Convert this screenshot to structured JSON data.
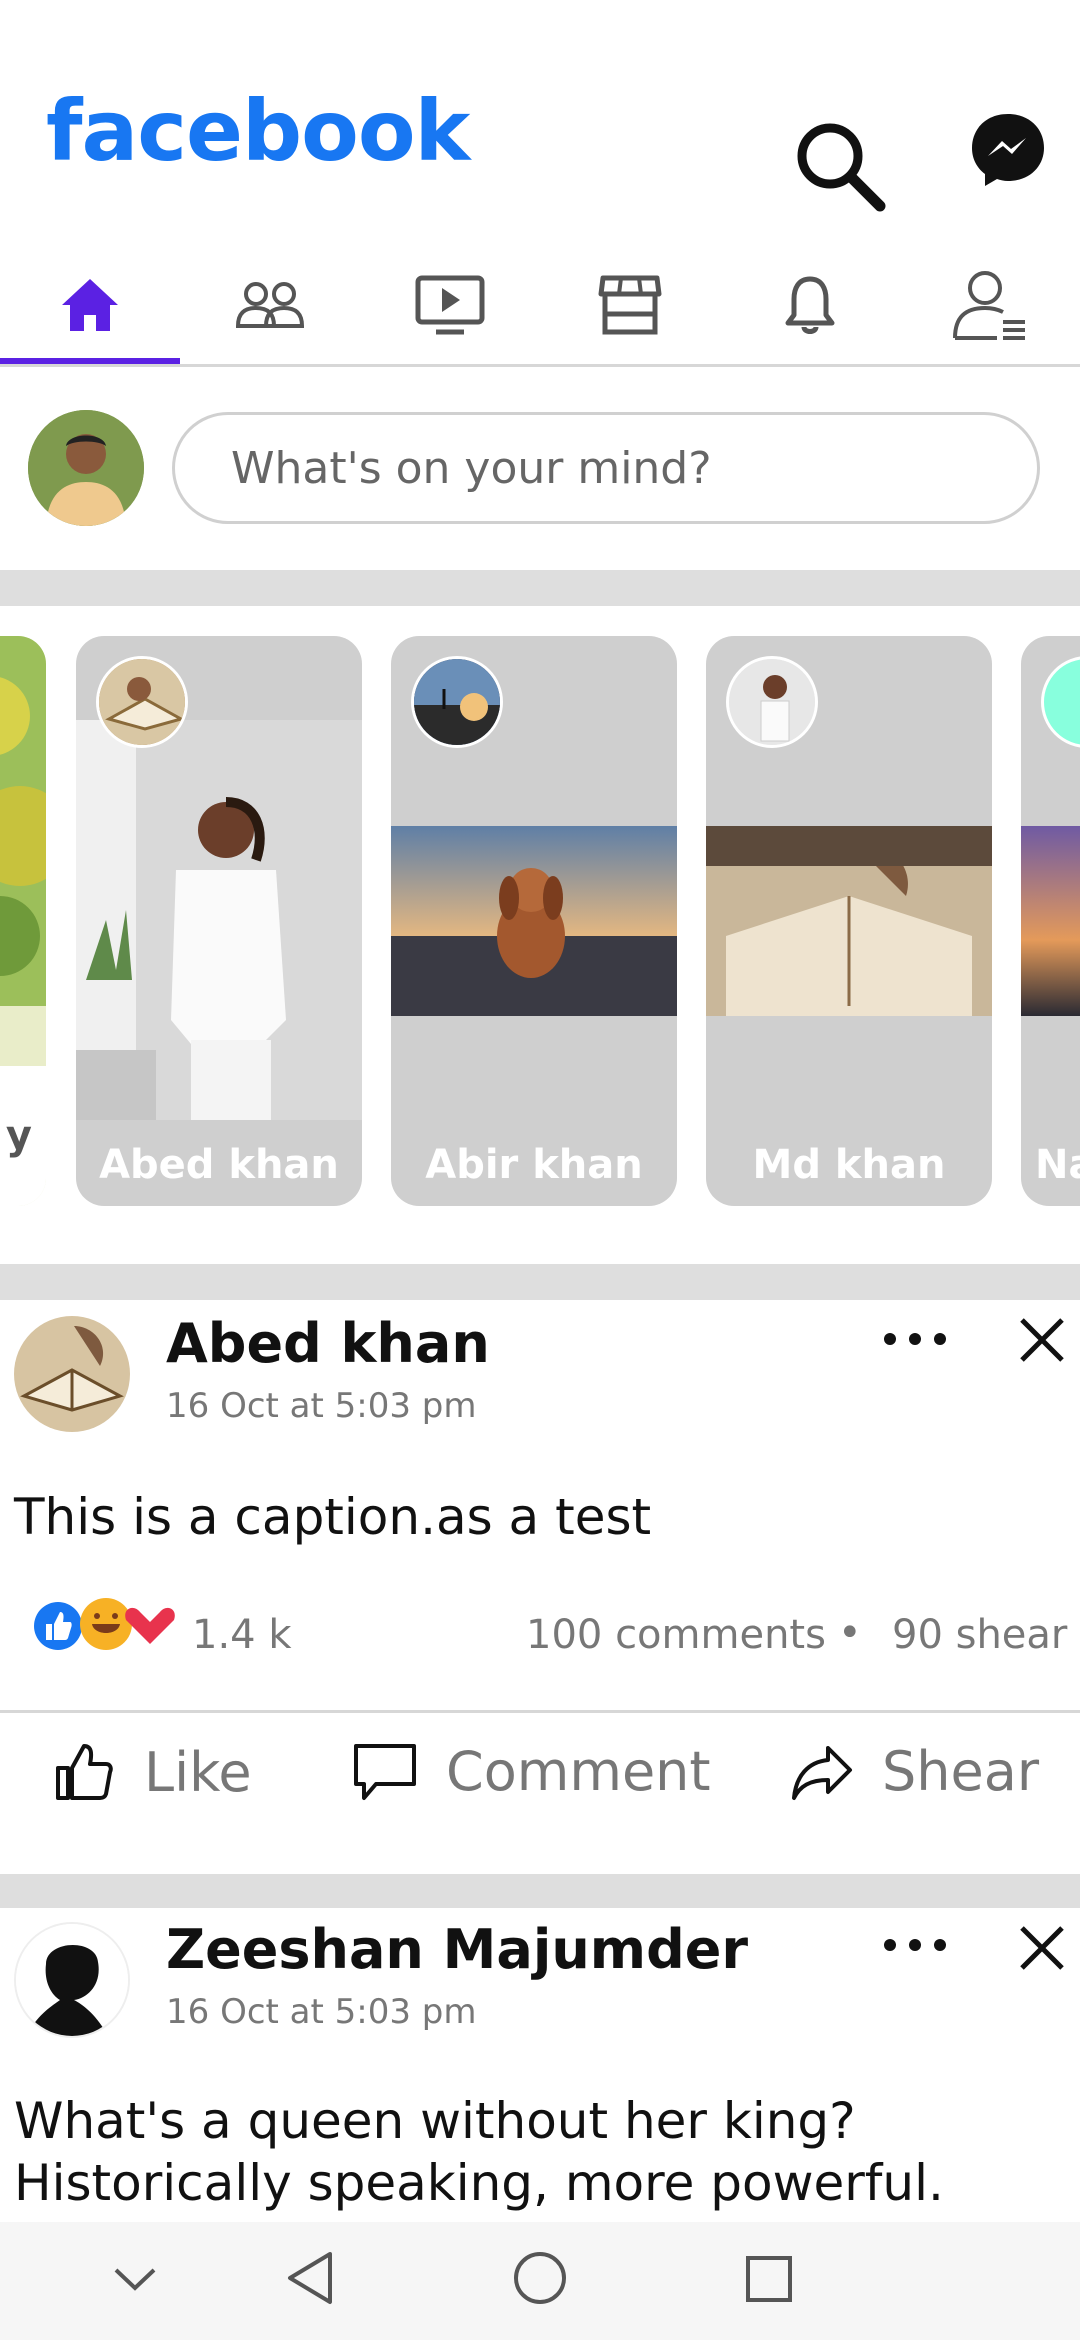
{
  "header": {
    "logo": "facebook",
    "search_icon": "search-icon",
    "messenger_icon": "messenger-icon"
  },
  "tabs": [
    {
      "name": "home",
      "icon": "home-icon",
      "active": true
    },
    {
      "name": "friends",
      "icon": "friends-icon",
      "active": false
    },
    {
      "name": "watch",
      "icon": "video-icon",
      "active": false
    },
    {
      "name": "marketplace",
      "icon": "store-icon",
      "active": false
    },
    {
      "name": "notifications",
      "icon": "bell-icon",
      "active": false
    },
    {
      "name": "menu",
      "icon": "profile-menu-icon",
      "active": false
    }
  ],
  "colors": {
    "brand": "#1877f2",
    "accent": "#5b21e3",
    "divider": "#dedede"
  },
  "composer": {
    "placeholder": "What's on your mind?"
  },
  "stories": [
    {
      "label": "y"
    },
    {
      "label": "Abed khan"
    },
    {
      "label": "Abir khan"
    },
    {
      "label": "Md khan"
    },
    {
      "label": "Na"
    }
  ],
  "posts": [
    {
      "name": "Abed khan",
      "time": "16 Oct at 5:03 pm",
      "caption": "This is a caption.as a test",
      "reactions": "1.4 k",
      "comments": "100 comments",
      "dot": "•",
      "shares": "90 shear",
      "actions": {
        "like": "Like",
        "comment": "Comment",
        "share": "Shear"
      }
    },
    {
      "name": "Zeeshan Majumder",
      "time": "16 Oct at 5:03 pm",
      "caption_line1": "What's a queen without her king?",
      "caption_line2": "Historically speaking, more powerful."
    }
  ]
}
